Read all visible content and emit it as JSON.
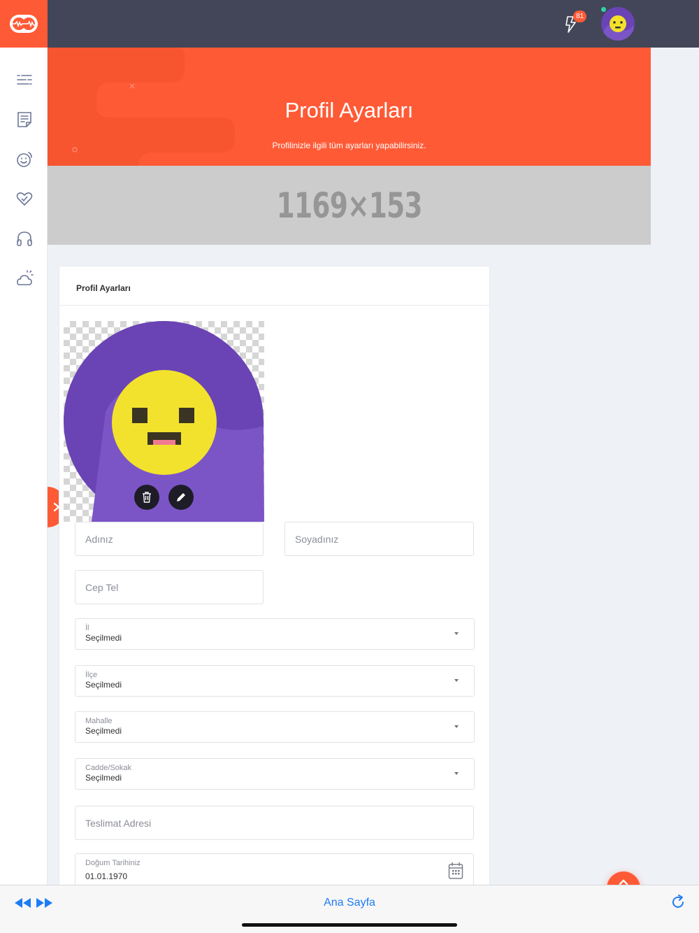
{
  "topbar": {
    "notification_count": "81",
    "icons": [
      "logo-icon",
      "notification-bell-icon",
      "user-avatar"
    ]
  },
  "sidebar": {
    "items": [
      {
        "icon": "list-icon"
      },
      {
        "icon": "document-icon"
      },
      {
        "icon": "chat-face-icon"
      },
      {
        "icon": "heart-icon"
      },
      {
        "icon": "headphones-icon"
      },
      {
        "icon": "weather-icon"
      }
    ]
  },
  "hero": {
    "title": "Profil Ayarları",
    "subtitle": "Profilinizle ilgili tüm ayarları yapabilirsiniz."
  },
  "banner": {
    "text": "1169×153"
  },
  "card": {
    "title": "Profil Ayarları"
  },
  "form": {
    "first_name_placeholder": "Adınız",
    "last_name_placeholder": "Soyadınız",
    "phone_placeholder": "Cep Tel",
    "province": {
      "label": "İl",
      "value": "Seçilmedi"
    },
    "district": {
      "label": "İlçe",
      "value": "Seçilmedi"
    },
    "neighborhood": {
      "label": "Mahalle",
      "value": "Seçilmedi"
    },
    "street": {
      "label": "Cadde/Sokak",
      "value": "Seçilmedi"
    },
    "delivery_address_placeholder": "Teslimat Adresi",
    "birth_date": {
      "label": "Doğum Tarihiniz",
      "value": "01.01.1970"
    }
  },
  "bottombar": {
    "home_label": "Ana Sayfa"
  },
  "colors": {
    "accent": "#ff5a36",
    "topbar": "#434658",
    "avatar_bg": "#6a43b4",
    "link": "#1e7cf2"
  }
}
